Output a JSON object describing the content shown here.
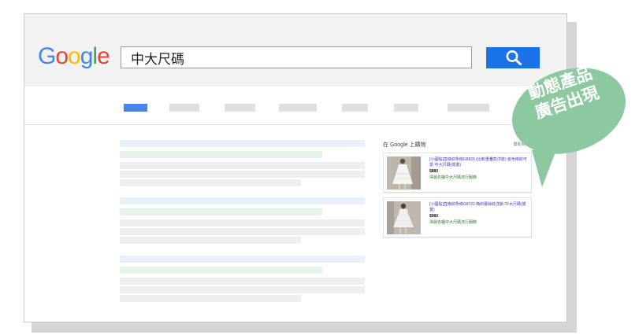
{
  "search": {
    "logo_letters": [
      {
        "char": "G",
        "color": "#4285F4"
      },
      {
        "char": "o",
        "color": "#EA4335"
      },
      {
        "char": "o",
        "color": "#FBBC05"
      },
      {
        "char": "g",
        "color": "#4285F4"
      },
      {
        "char": "l",
        "color": "#34A853"
      },
      {
        "char": "e",
        "color": "#EA4335"
      }
    ],
    "query": "中大尺碼",
    "button_icon": "search-icon",
    "button_color": "#1a73e8"
  },
  "tabs": {
    "active_color": "#4a86e8",
    "inactive_color": "#e0e0e0"
  },
  "shopping": {
    "heading": "在 Google 上購物",
    "ad_label": "贊助商 ⓘ",
    "products": [
      {
        "title": "[小圓點]直條紋魚條G8826 (比較重疊款洋裝) 金色條紋可愛-中大尺碼(閒置)",
        "price": "$880",
        "store": "澤晨衣櫃中大尺碼流行服飾"
      },
      {
        "title": "[小圓點]直條紋魚條G8722 簡約蕾絲紋洋裝-中大尺碼(閒置)",
        "price": "$980",
        "store": "澤晨衣櫃中大尺碼流行服飾"
      }
    ]
  },
  "callout": {
    "lines": [
      "動態產品",
      "廣告出現"
    ],
    "color": "#8cc9a0"
  }
}
